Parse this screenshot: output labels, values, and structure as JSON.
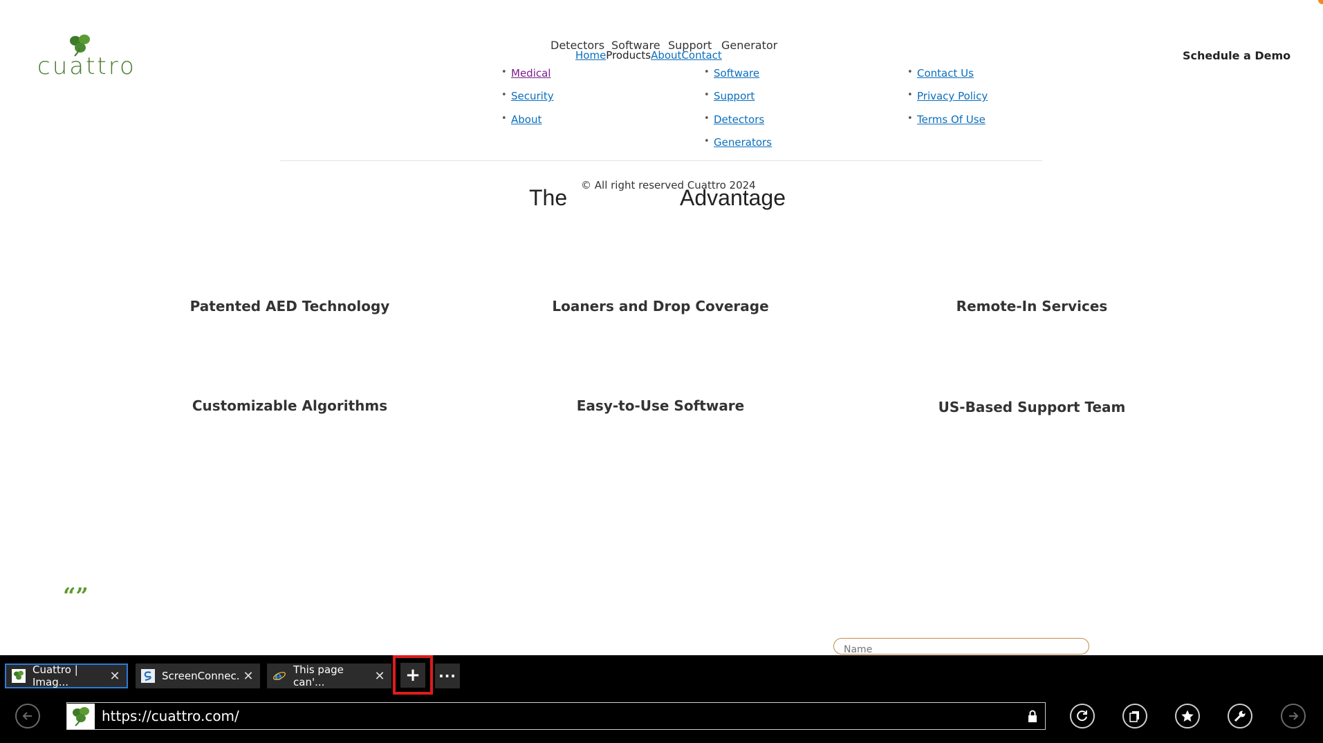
{
  "site": {
    "logo_text": "cuattro",
    "nav_top": [
      "Detectors",
      "Software",
      "Support",
      "Generator"
    ],
    "nav": {
      "home": "Home",
      "products": "Products",
      "about": "About",
      "contact": "Contact"
    },
    "demo_button": "Schedule a Demo",
    "footer": {
      "col1": [
        "Medical",
        "Security",
        "About"
      ],
      "col2": [
        "Software",
        "Support",
        "Detectors",
        "Generators"
      ],
      "col3": [
        "Contact Us",
        "Privacy Policy",
        "Terms Of Use"
      ],
      "copyright": "© All right reserved Cuattro 2024"
    },
    "advantage": {
      "word1": "The",
      "word2": "Advantage"
    },
    "features": [
      "Patented AED Technology",
      "Loaners and Drop Coverage",
      "Remote-In Services",
      "Customizable Algorithms",
      "Easy-to-Use Software",
      "US-Based Support Team"
    ],
    "quote_mark": "“”",
    "form": {
      "name_placeholder": "Name"
    }
  },
  "browser": {
    "tabs": [
      {
        "title": "Cuattro | Imag...",
        "active": true,
        "icon": "cuattro-leaf-icon"
      },
      {
        "title": "ScreenConnec...",
        "active": false,
        "icon": "screenconnect-icon"
      },
      {
        "title": "This page can'...",
        "active": false,
        "icon": "ie-icon"
      }
    ],
    "new_tab_label": "+",
    "more_label": "···",
    "url": "https://cuattro.com/",
    "colors": {
      "highlight": "#e01b1b",
      "active_tab_border": "#2b7bd8",
      "brand_green": "#4a7a2e"
    }
  }
}
